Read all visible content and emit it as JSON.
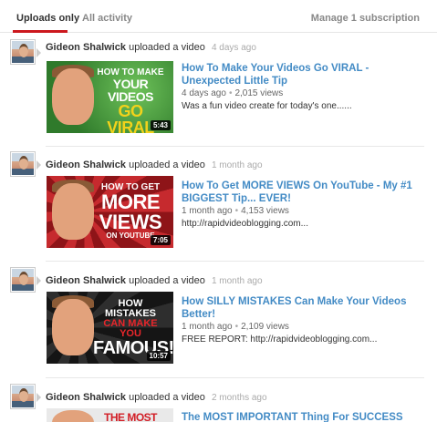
{
  "tabs": {
    "uploads_label": "Uploads only",
    "activity_label": "All activity",
    "manage_label": "Manage 1 subscription"
  },
  "feed": [
    {
      "author": "Gideon Shalwick",
      "action": "uploaded a video",
      "time": "4 days ago",
      "title": "How To Make Your Videos Go VIRAL - Unexpected Little Tip",
      "age": "4 days ago",
      "views": "2,015 views",
      "description": "Was a fun video create for today's one......",
      "duration": "5:43",
      "thumb_lines": [
        "How to make",
        "your videos",
        "go viral"
      ],
      "thumb_colors": {
        "bg": "#3f8f3a",
        "accent": "#f2d21b"
      }
    },
    {
      "author": "Gideon Shalwick",
      "action": "uploaded a video",
      "time": "1 month ago",
      "title": "How To Get MORE VIEWS On YouTube - My #1 BIGGEST Tip... EVER!",
      "age": "1 month ago",
      "views": "4,153 views",
      "description": "http://rapidvideoblogging.com...",
      "duration": "7:05",
      "thumb_lines": [
        "How to get",
        "more",
        "views"
      ],
      "thumb_sub": "on YouTube",
      "thumb_colors": {
        "bg": "#b32024",
        "accent": "#ffffff"
      }
    },
    {
      "author": "Gideon Shalwick",
      "action": "uploaded a video",
      "time": "1 month ago",
      "title": "How SILLY MISTAKES Can Make Your Videos Better!",
      "age": "1 month ago",
      "views": "2,109 views",
      "description": "FREE REPORT: http://rapidvideoblogging.com...",
      "duration": "10:57",
      "thumb_lines": [
        "How mistakes",
        "can make you",
        "famous!"
      ],
      "thumb_colors": {
        "bg": "#1c1c1c",
        "accent": "#ffffff",
        "accent2": "#e8262b"
      }
    },
    {
      "author": "Gideon Shalwick",
      "action": "uploaded a video",
      "time": "2 months ago",
      "title": "The MOST IMPORTANT Thing For SUCCESS",
      "thumb_lines": [
        "The MOST"
      ],
      "thumb_colors": {
        "bg": "#e9e9e9",
        "accent": "#d21e26"
      }
    }
  ]
}
